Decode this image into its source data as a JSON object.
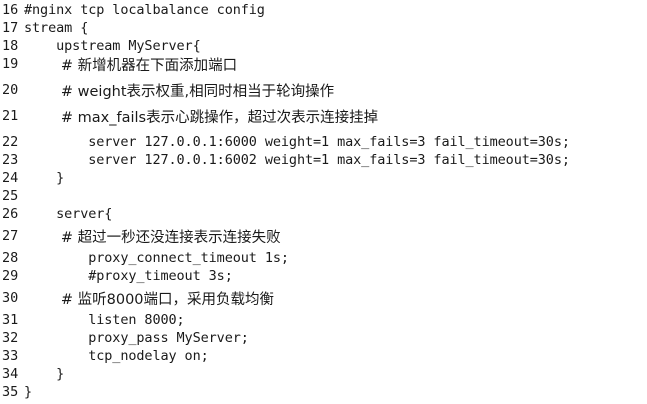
{
  "editor": {
    "lines": [
      {
        "num": "16",
        "text": "#nginx tcp localbalance config"
      },
      {
        "num": "17",
        "text": "stream {"
      },
      {
        "num": "18",
        "text": "    upstream MyServer{"
      },
      {
        "num": "19",
        "text": "        # 新增机器在下面添加端口"
      },
      {
        "num": "20",
        "text": "        # weight表示权重,相同时相当于轮询操作"
      },
      {
        "num": "21",
        "text": "        # max_fails表示心跳操作，超过次表示连接挂掉"
      },
      {
        "num": "22",
        "text": "        server 127.0.0.1:6000 weight=1 max_fails=3 fail_timeout=30s;"
      },
      {
        "num": "23",
        "text": "        server 127.0.0.1:6002 weight=1 max_fails=3 fail_timeout=30s;"
      },
      {
        "num": "24",
        "text": "    }"
      },
      {
        "num": "25",
        "text": ""
      },
      {
        "num": "26",
        "text": "    server{"
      },
      {
        "num": "27",
        "text": "        # 超过一秒还没连接表示连接失败"
      },
      {
        "num": "28",
        "text": "        proxy_connect_timeout 1s;"
      },
      {
        "num": "29",
        "text": "        #proxy_timeout 3s;"
      },
      {
        "num": "30",
        "text": "        # 监听8000端口，采用负载均衡"
      },
      {
        "num": "31",
        "text": "        listen 8000;"
      },
      {
        "num": "32",
        "text": "        proxy_pass MyServer;"
      },
      {
        "num": "33",
        "text": "        tcp_nodelay on;"
      },
      {
        "num": "34",
        "text": "    }"
      },
      {
        "num": "35",
        "text": "}"
      }
    ]
  }
}
